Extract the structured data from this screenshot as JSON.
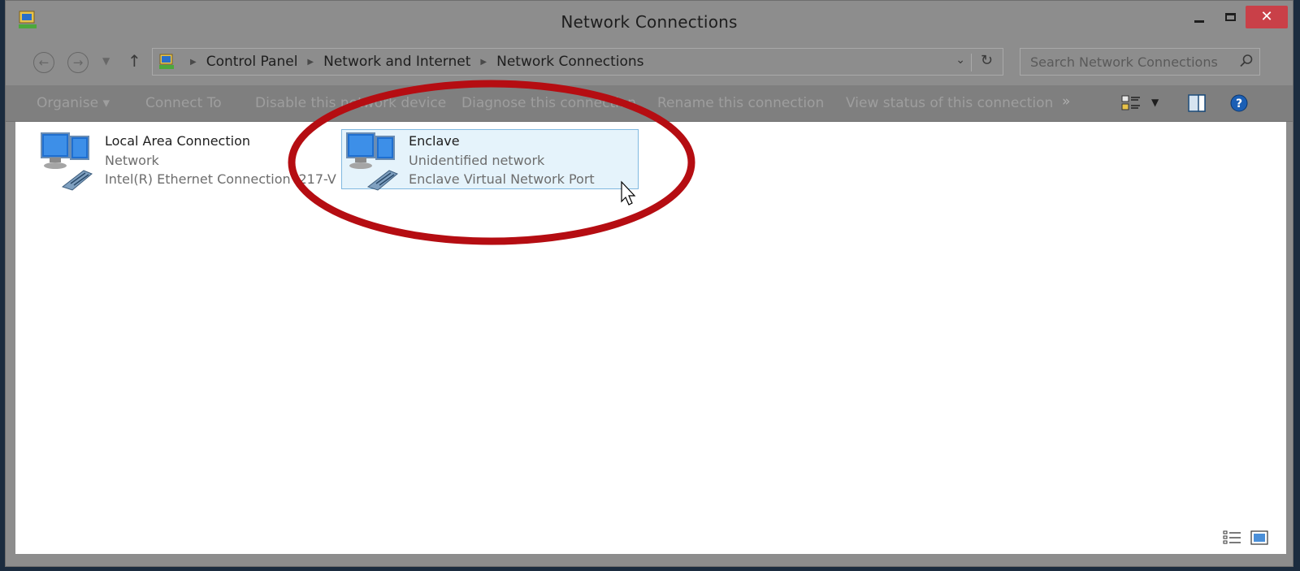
{
  "window": {
    "title": "Network Connections"
  },
  "nav": {
    "breadcrumbs": [
      "Control Panel",
      "Network and Internet",
      "Network Connections"
    ],
    "search_placeholder": "Search Network Connections"
  },
  "toolbar": {
    "organise": "Organise ▾",
    "connect_to": "Connect To",
    "disable": "Disable this network device",
    "diagnose": "Diagnose this connection",
    "rename": "Rename this connection",
    "view_status": "View status of this connection",
    "more": "»"
  },
  "connections": [
    {
      "name": "Local Area Connection",
      "status": "Network",
      "device": "Intel(R) Ethernet Connection I217-V"
    },
    {
      "name": "Enclave",
      "status": "Unidentified network",
      "device": "Enclave Virtual Network Port",
      "selected": true
    }
  ],
  "colors": {
    "highlight_circle": "#b50d12",
    "selection_fill": "#e5f3fb",
    "selection_border": "#80b8e0",
    "close_button": "#c94048"
  }
}
